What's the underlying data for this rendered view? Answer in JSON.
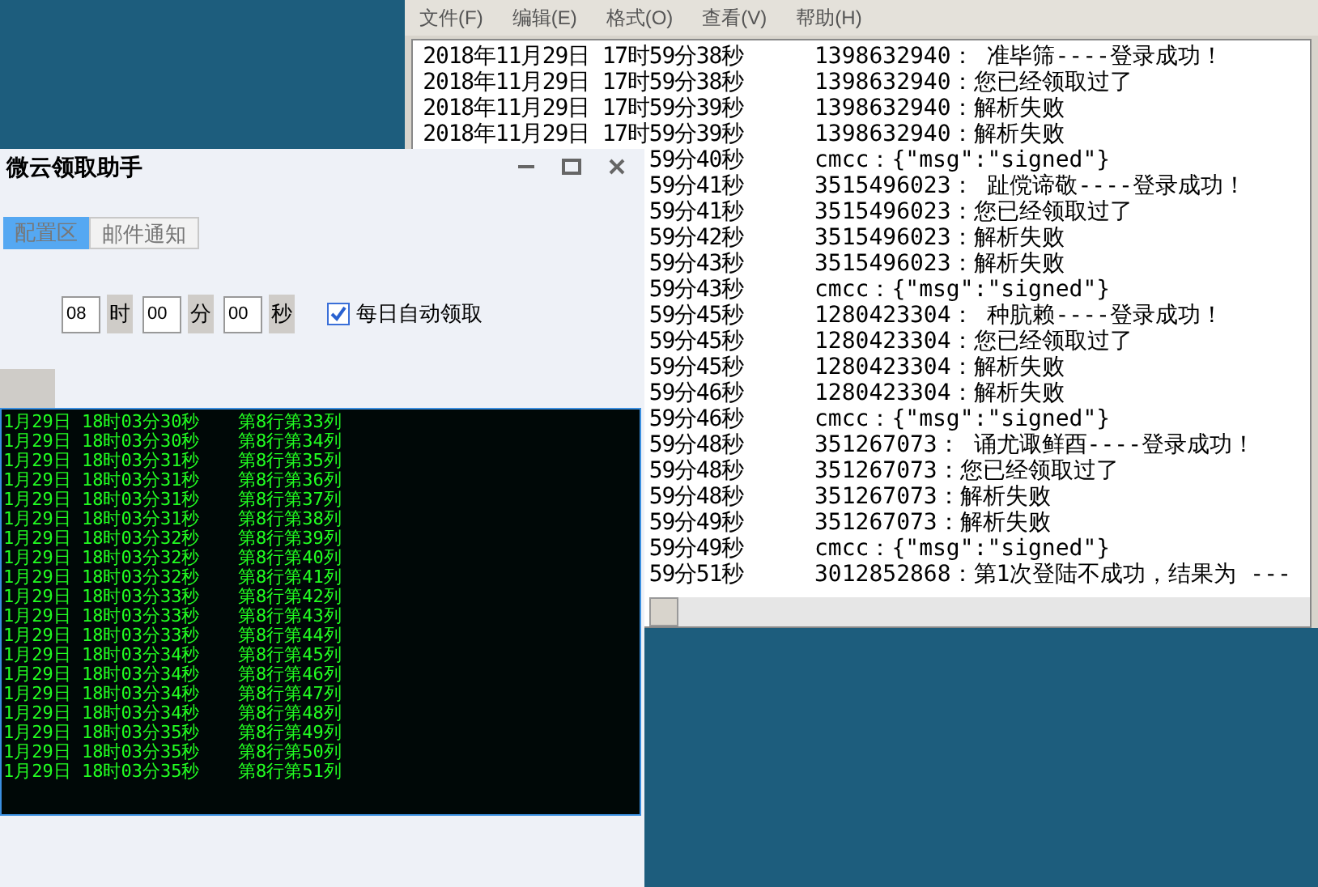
{
  "notepad": {
    "menu": [
      "文件(F)",
      "编辑(E)",
      "格式(O)",
      "查看(V)",
      "帮助(H)"
    ],
    "lines": [
      {
        "time": "2018年11月29日 17时59分38秒",
        "text": "1398632940：  准毕筛----登录成功！"
      },
      {
        "time": "2018年11月29日 17时59分38秒",
        "text": "1398632940：您已经领取过了"
      },
      {
        "time": "2018年11月29日 17时59分39秒",
        "text": "1398632940：解析失败"
      },
      {
        "time": "2018年11月29日 17时59分39秒",
        "text": "1398632940：解析失败"
      },
      {
        "time": "59分40秒",
        "text": "cmcc：{\"msg\":\"signed\"}"
      },
      {
        "time": "59分41秒",
        "text": "3515496023：  趾傥谛敬----登录成功！"
      },
      {
        "time": "59分41秒",
        "text": "3515496023：您已经领取过了"
      },
      {
        "time": "59分42秒",
        "text": "3515496023：解析失败"
      },
      {
        "time": "59分43秒",
        "text": "3515496023：解析失败"
      },
      {
        "time": "59分43秒",
        "text": "cmcc：{\"msg\":\"signed\"}"
      },
      {
        "time": "59分45秒",
        "text": "1280423304：  种肮赖----登录成功！"
      },
      {
        "time": "59分45秒",
        "text": "1280423304：您已经领取过了"
      },
      {
        "time": "59分45秒",
        "text": "1280423304：解析失败"
      },
      {
        "time": "59分46秒",
        "text": "1280423304：解析失败"
      },
      {
        "time": "59分46秒",
        "text": "cmcc：{\"msg\":\"signed\"}"
      },
      {
        "time": "59分48秒",
        "text": "351267073：  诵尤诹鲜酉----登录成功！"
      },
      {
        "time": "59分48秒",
        "text": "351267073：您已经领取过了"
      },
      {
        "time": "59分48秒",
        "text": "351267073：解析失败"
      },
      {
        "time": "59分49秒",
        "text": "351267073：解析失败"
      },
      {
        "time": "59分49秒",
        "text": "cmcc：{\"msg\":\"signed\"}"
      },
      {
        "time": "59分51秒",
        "text": "3012852868：第1次登陆不成功，结果为 ---"
      }
    ]
  },
  "app": {
    "title": "微云领取助手",
    "tabs": [
      {
        "label": "配置区",
        "selected": true
      },
      {
        "label": "邮件通知",
        "selected": false
      }
    ],
    "schedule": [
      {
        "value": "08",
        "unit": "时"
      },
      {
        "value": "00",
        "unit": "分"
      },
      {
        "value": "00",
        "unit": "秒"
      }
    ],
    "daily_auto": {
      "label": "每日自动领取",
      "checked": true
    },
    "console": [
      {
        "time": "1月29日 18时03分30秒",
        "pos": "第8行第33列"
      },
      {
        "time": "1月29日 18时03分30秒",
        "pos": "第8行第34列"
      },
      {
        "time": "1月29日 18时03分31秒",
        "pos": "第8行第35列"
      },
      {
        "time": "1月29日 18时03分31秒",
        "pos": "第8行第36列"
      },
      {
        "time": "1月29日 18时03分31秒",
        "pos": "第8行第37列"
      },
      {
        "time": "1月29日 18时03分31秒",
        "pos": "第8行第38列"
      },
      {
        "time": "1月29日 18时03分32秒",
        "pos": "第8行第39列"
      },
      {
        "time": "1月29日 18时03分32秒",
        "pos": "第8行第40列"
      },
      {
        "time": "1月29日 18时03分32秒",
        "pos": "第8行第41列"
      },
      {
        "time": "1月29日 18时03分33秒",
        "pos": "第8行第42列"
      },
      {
        "time": "1月29日 18时03分33秒",
        "pos": "第8行第43列"
      },
      {
        "time": "1月29日 18时03分33秒",
        "pos": "第8行第44列"
      },
      {
        "time": "1月29日 18时03分34秒",
        "pos": "第8行第45列"
      },
      {
        "time": "1月29日 18时03分34秒",
        "pos": "第8行第46列"
      },
      {
        "time": "1月29日 18时03分34秒",
        "pos": "第8行第47列"
      },
      {
        "time": "1月29日 18时03分34秒",
        "pos": "第8行第48列"
      },
      {
        "time": "1月29日 18时03分35秒",
        "pos": "第8行第49列"
      },
      {
        "time": "1月29日 18时03分35秒",
        "pos": "第8行第50列"
      },
      {
        "time": "1月29日 18时03分35秒",
        "pos": "第8行第51列"
      }
    ]
  }
}
